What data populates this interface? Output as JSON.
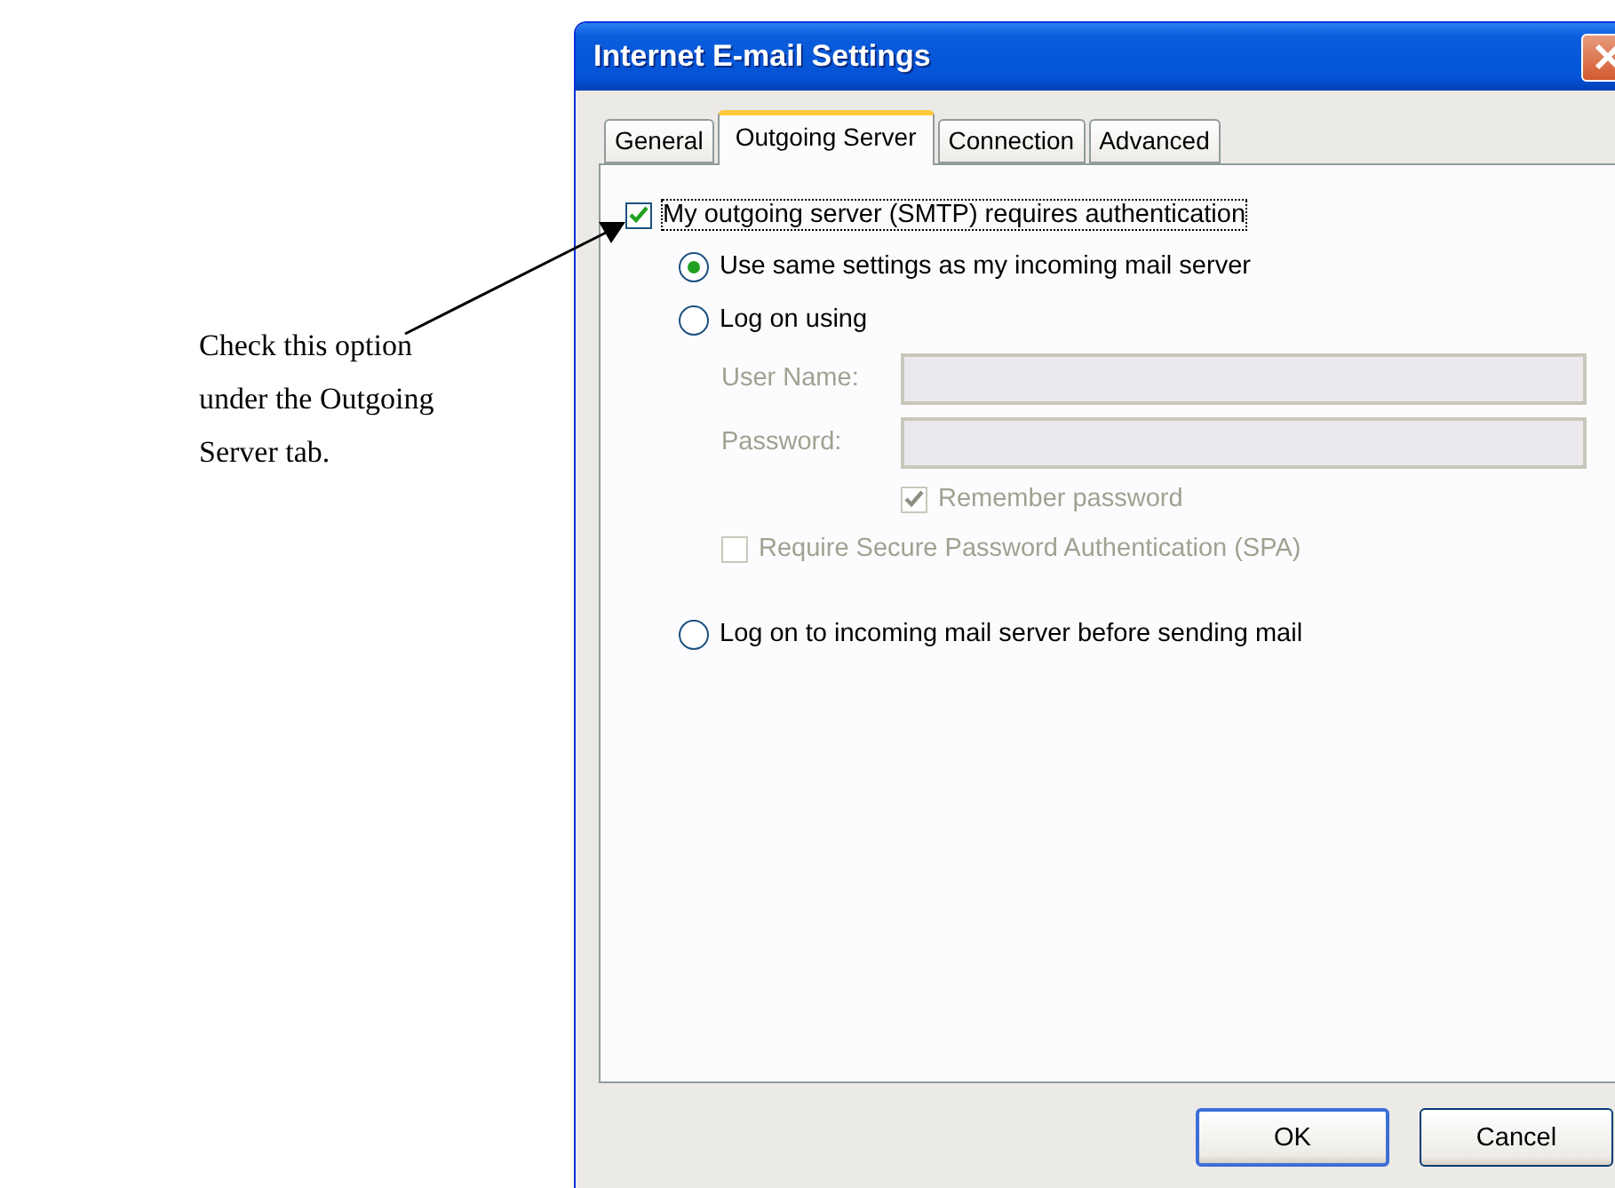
{
  "annotation": {
    "text": "Check this option under the Outgoing Server tab."
  },
  "dialog": {
    "title": "Internet E-mail Settings",
    "tabs": [
      {
        "label": "General",
        "selected": false
      },
      {
        "label": "Outgoing Server",
        "selected": true
      },
      {
        "label": "Connection",
        "selected": false
      },
      {
        "label": "Advanced",
        "selected": false
      }
    ],
    "requires_auth": {
      "label": "My outgoing server (SMTP) requires authentication",
      "checked": true
    },
    "logon_options": [
      {
        "label": "Use same settings as my incoming mail server",
        "selected": true
      },
      {
        "label": "Log on using",
        "selected": false,
        "fields": [
          {
            "label": "User Name:",
            "disabled": true
          },
          {
            "label": "Password:",
            "disabled": true
          }
        ],
        "remember": {
          "label": "Remember password",
          "checked": true,
          "disabled": true
        },
        "spa": {
          "label": "Require Secure Password Authentication (SPA)",
          "checked": false,
          "disabled": true
        }
      },
      {
        "label": "Log on to incoming mail server before sending mail",
        "selected": false
      }
    ],
    "buttons": [
      {
        "label": "OK",
        "default": true
      },
      {
        "label": "Cancel",
        "default": false
      }
    ]
  }
}
